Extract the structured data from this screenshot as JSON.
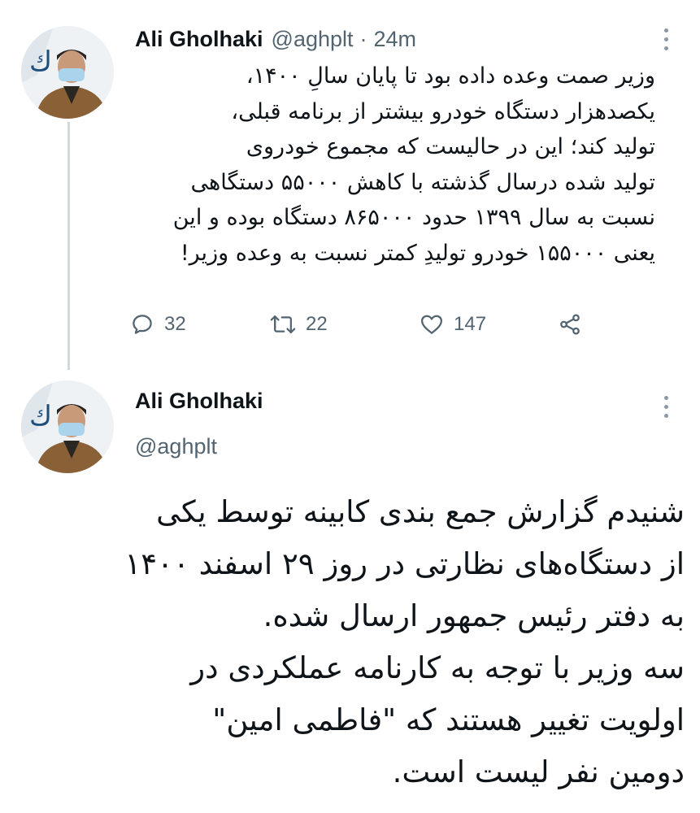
{
  "tweet1": {
    "author_name": "Ali Gholhaki",
    "author_handle": "@aghplt",
    "separator": "·",
    "timestamp": "24m",
    "text": "وزیر صمت وعده داده بود تا پایان سالِ ۱۴۰۰،\nیکصدهزار دستگاه خودرو بیشتر از برنامه قبلی،\nتولید کند؛ این در حالیست که مجموع خودروی\nتولید شده درسال گذشته با کاهش ۵۵۰۰۰ دستگاهی\nنسبت به سال ۱۳۹۹ حدود ۸۶۵۰۰۰ دستگاه بوده و این\nیعنی ۱۵۵۰۰۰ خودرو تولیدِ کمتر نسبت به وعده وزیر!",
    "actions": {
      "replies": "32",
      "retweets": "22",
      "likes": "147"
    },
    "icons": {
      "reply": "reply-icon",
      "retweet": "retweet-icon",
      "like": "heart-icon",
      "share": "share-icon",
      "more": "more-vertical-icon"
    }
  },
  "tweet2": {
    "author_name": "Ali Gholhaki",
    "author_handle": "@aghplt",
    "text": "شنیدم گزارش جمع بندی کابینه توسط یکی\nاز دستگاه‌های نظارتی در روز ۲۹ اسفند ۱۴۰۰\nبه دفتر رئیس جمهور ارسال شده.\nسه وزیر با توجه به کارنامه عملکردی در\nاولویت تغییر هستند که \"فاطمی امین\"\nدومین نفر لیست است."
  },
  "colors": {
    "text_primary": "#0f1419",
    "text_secondary": "#536471",
    "thread_line": "#cfd9de",
    "background": "#ffffff"
  }
}
